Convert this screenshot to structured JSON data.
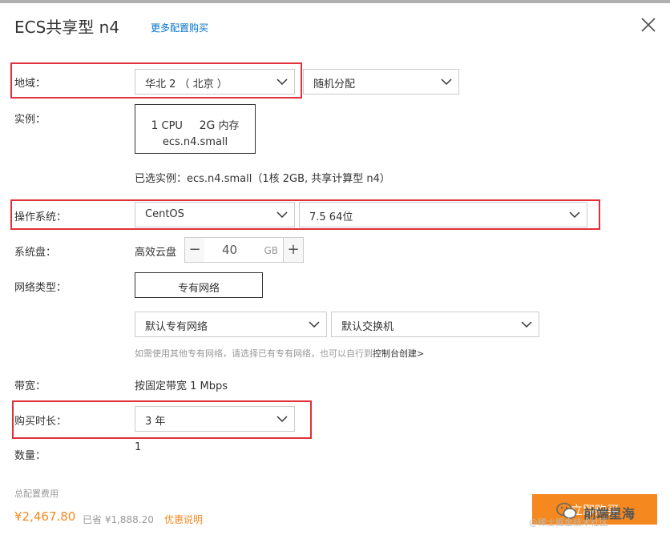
{
  "dialog": {
    "title": "ECS共享型 n4",
    "more_link": "更多配置购买",
    "close_icon": "close-icon"
  },
  "region": {
    "label": "地域：",
    "primary_value": "华北 2 （ 北京 ）",
    "secondary_value": "随机分配"
  },
  "instance": {
    "label": "实例：",
    "cpu_num": "1",
    "cpu_unit": "CPU",
    "mem_num": "2G",
    "mem_unit": "内存",
    "spec": "ecs.n4.small",
    "selected_text": "已选实例：ecs.n4.small（1核 2GB, 共享计算型 n4）"
  },
  "os": {
    "label": "操作系统：",
    "type_value": "CentOS",
    "version_value": "7.5 64位"
  },
  "disk": {
    "label": "系统盘：",
    "type": "高效云盘",
    "minus": "−",
    "size": "40",
    "unit": "GB",
    "plus": "+"
  },
  "network": {
    "label": "网络类型：",
    "type_button": "专有网络",
    "vpc_value": "默认专有网络",
    "vswitch_value": "默认交换机",
    "hint_prefix": "如需使用其他专有网络，请选择已有专有网络，也可以自行到",
    "hint_link": "控制台创建>"
  },
  "bandwidth": {
    "label": "带宽：",
    "value": "按固定带宽 1 Mbps"
  },
  "duration": {
    "label": "购买时长：",
    "value": "3 年"
  },
  "quantity": {
    "label": "数量：",
    "value": "1"
  },
  "cost": {
    "label": "总配置费用",
    "price": "¥2,467.80",
    "saved": "已省 ¥1,888.20",
    "promo_link": "优惠说明"
  },
  "buy_button": {
    "label": "立即购买"
  },
  "watermark": {
    "text": "前端星海",
    "subtext": "@稀土掘金技术社区"
  },
  "colors": {
    "highlight_border": "#e0303a",
    "accent_orange": "#f5891f",
    "link_blue": "#0070cc"
  }
}
